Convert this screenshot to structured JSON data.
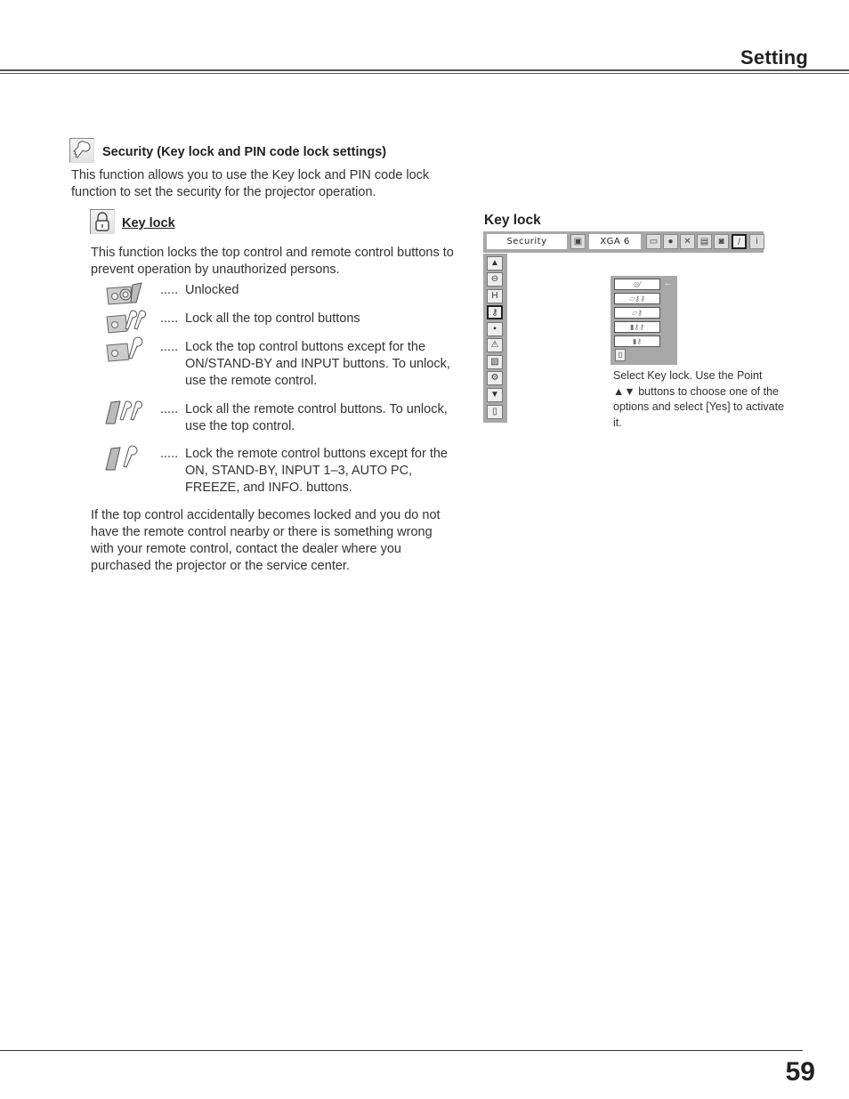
{
  "header": {
    "section_title": "Setting"
  },
  "footer": {
    "page_number": "59"
  },
  "security": {
    "icon": "key-icon",
    "title": "Security (Key lock and PIN code lock settings)",
    "intro": "This function allows you to use the Key lock and PIN code lock function to set the security for the projector operation."
  },
  "key_lock": {
    "icon": "padlock-icon",
    "title": "Key lock",
    "description": "This function locks the top control and remote control buttons to prevent operation by unauthorized persons.",
    "options": [
      {
        "icon": "projector-unlocked-icon",
        "dots": ".....",
        "text": "Unlocked"
      },
      {
        "icon": "projector-two-keys-icon",
        "dots": ".....",
        "text": "Lock all the top control buttons"
      },
      {
        "icon": "projector-one-key-icon",
        "dots": ".....",
        "text": "Lock the top control buttons except for the ON/STAND-BY and INPUT buttons. To unlock, use the remote control."
      },
      {
        "icon": "remote-two-keys-icon",
        "dots": ".....",
        "text": "Lock all the remote control buttons. To unlock, use the top control."
      },
      {
        "icon": "remote-one-key-icon",
        "dots": ".....",
        "text": "Lock the remote control buttons except for the ON, STAND-BY, INPUT 1–3, AUTO PC, FREEZE, and INFO. buttons."
      }
    ],
    "note": "If the top control accidentally becomes locked and you do not have the remote control nearby or there is something wrong with your remote control, contact the dealer where you purchased the projector or the service center."
  },
  "osd": {
    "title": "Key lock",
    "menu_bar": {
      "current_menu": "Security",
      "input_label": "XGA 6",
      "icons": [
        "input-icon",
        "pc-adjust-icon",
        "image-select-icon",
        "image-adjust-icon",
        "screen-icon",
        "sound-icon",
        "setting-icon",
        "information-icon"
      ]
    },
    "side_icons": [
      "scroll-up-icon",
      "security-menu-icon",
      "hdmi-icon",
      "key-lock-icon",
      "pin-code-icon",
      "warning-icon",
      "logo-icon",
      "remote-icon",
      "scroll-down-icon",
      "exit-icon"
    ],
    "sub_options": [
      "projector-unlocked",
      "projector-two-keys",
      "projector-one-key",
      "remote-two-keys",
      "remote-one-key"
    ],
    "selected_arrow": "←",
    "caption": "Select Key lock. Use the Point ▲▼ buttons to choose one of the options and select [Yes] to activate it."
  }
}
